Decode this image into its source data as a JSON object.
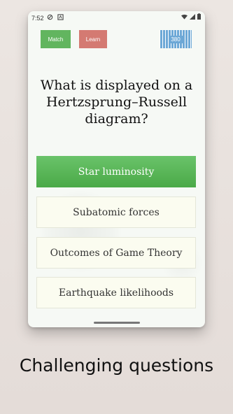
{
  "status_bar": {
    "time": "7:52",
    "icons": [
      "shield-icon",
      "notification-icon",
      "wifi-icon",
      "signal-icon",
      "battery-icon"
    ]
  },
  "header": {
    "match_label": "Match",
    "learn_label": "Learn",
    "score": "380"
  },
  "colors": {
    "match": "#62b55f",
    "learn": "#d47a72",
    "score": "#6da8d6",
    "correct_answer": "#52b050"
  },
  "quiz": {
    "question": "What is displayed on a Hertzsprung–Russell diagram?",
    "answers": [
      {
        "label": "Star luminosity",
        "state": "correct"
      },
      {
        "label": "Subatomic forces",
        "state": "neutral"
      },
      {
        "label": "Outcomes of Game Theory",
        "state": "neutral"
      },
      {
        "label": "Earthquake likelihoods",
        "state": "neutral"
      }
    ]
  },
  "caption": "Challenging questions"
}
